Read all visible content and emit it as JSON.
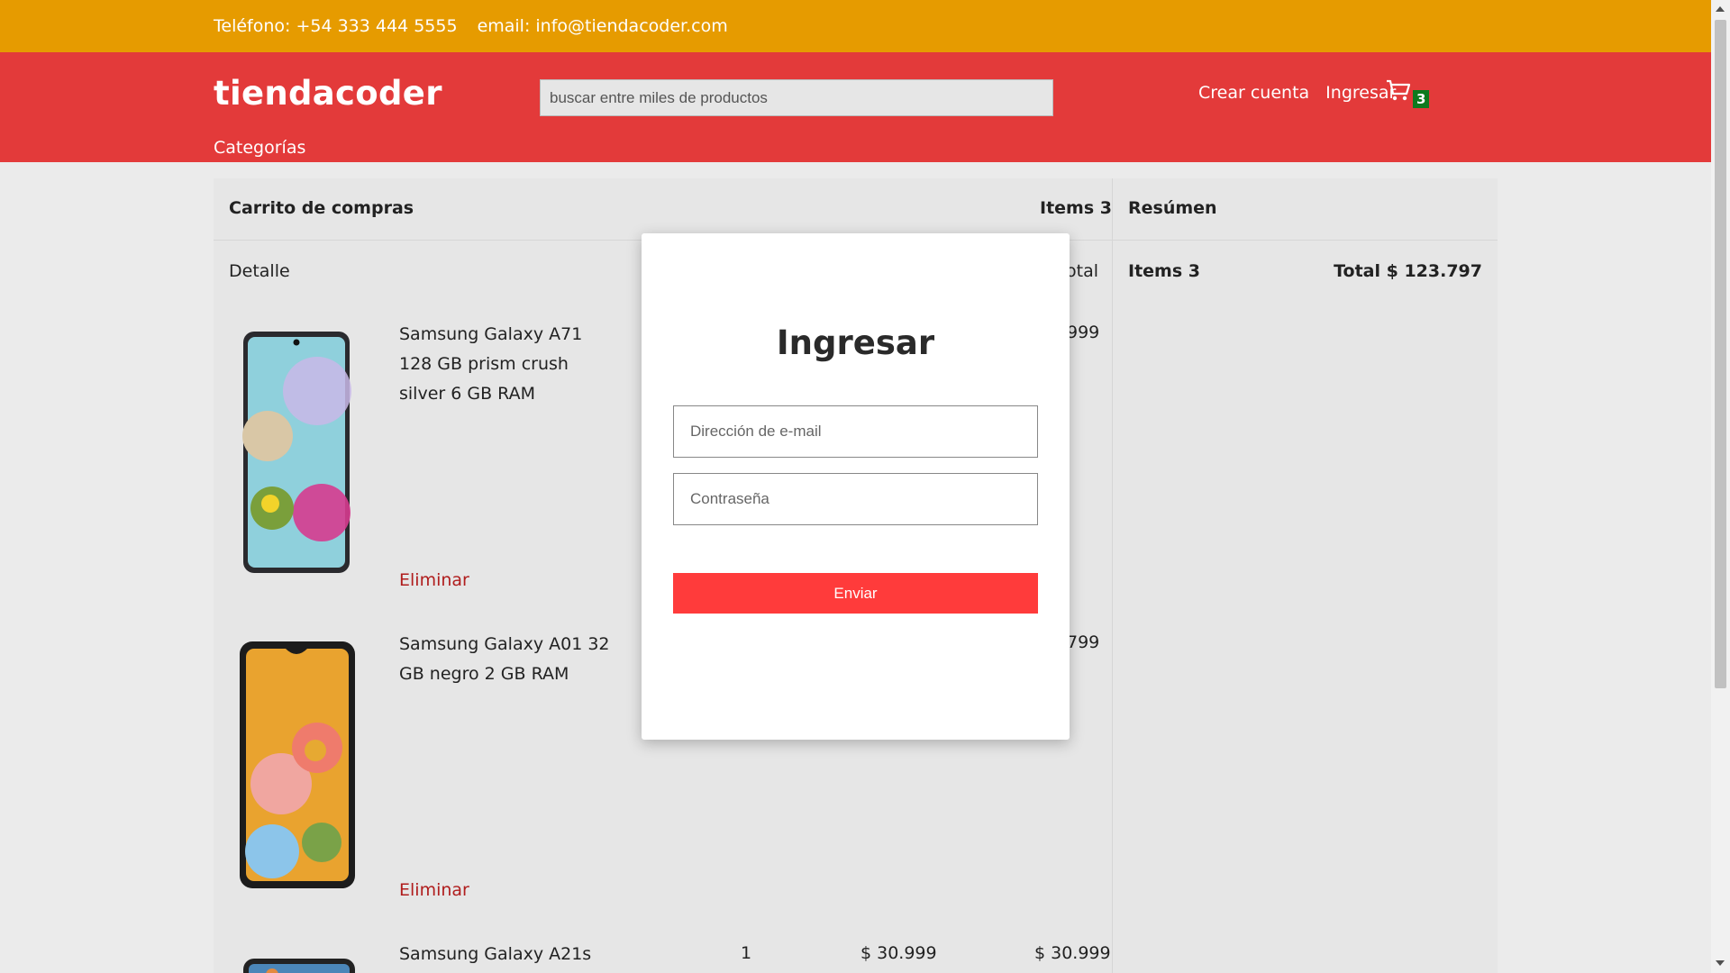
{
  "topbar": {
    "phone": "Teléfono: +54 333 444 5555",
    "email": "email: info@tiendacoder.com"
  },
  "header": {
    "logo": "tiendacoder",
    "search_placeholder": "buscar entre miles de productos",
    "create_account": "Crear cuenta",
    "login": "Ingresar",
    "cart_icon": "cart-icon",
    "cart_count": "3",
    "categories": "Categorías"
  },
  "cart": {
    "title": "Carrito de compras",
    "items_label": "Items 3",
    "detail_label": "Detalle",
    "total_col_label": "otal",
    "items": [
      {
        "name": "Samsung Galaxy A71 128 GB prism crush silver 6 GB RAM",
        "total_partial": "999",
        "remove": "Eliminar"
      },
      {
        "name": "Samsung Galaxy A01 32 GB negro 2 GB RAM",
        "total_partial": "799",
        "remove": "Eliminar"
      },
      {
        "name": "Samsung Galaxy A21s",
        "qty": "1",
        "price": "$ 30.999",
        "total": "$ 30.999"
      }
    ]
  },
  "summary": {
    "title": "Resúmen",
    "items": "Items 3",
    "total": "Total $ 123.797"
  },
  "modal": {
    "title": "Ingresar",
    "email_placeholder": "Dirección de e-mail",
    "password_placeholder": "Contraseña",
    "submit": "Enviar"
  },
  "colors": {
    "topbar": "#e69b00",
    "header": "#e33a3a",
    "submit": "#ff3b3b",
    "badge": "#0d7a1e",
    "remove_link": "#b01d1d"
  }
}
